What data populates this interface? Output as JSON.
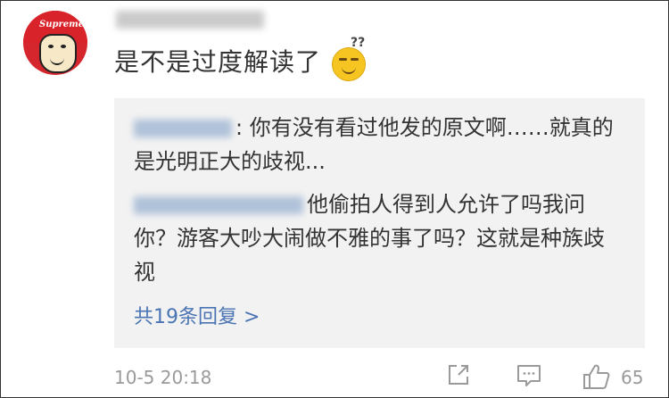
{
  "comment": {
    "avatar_icon": "supreme-cap-face-avatar",
    "avatar_text": "Supreme",
    "text": "是不是过度解读了",
    "emoji": "thinking-smile-emoji"
  },
  "replies": {
    "items": [
      {
        "text": ": 你有没有看过他发的原文啊……就真的是光明正大的歧视..."
      },
      {
        "text": "他偷拍人得到人允许了吗我问你？游客大吵大闹做不雅的事了吗？这就是种族歧视"
      }
    ],
    "more_label": "共19条回复 >"
  },
  "footer": {
    "timestamp": "10-5 20:18",
    "like_count": "65",
    "icons": [
      "share-icon",
      "comment-icon",
      "like-icon"
    ]
  },
  "colors": {
    "link": "#4a74b3",
    "secondary_text": "#9a9a9a",
    "reply_bg": "#f2f2f2",
    "avatar_red": "#d8232a"
  }
}
